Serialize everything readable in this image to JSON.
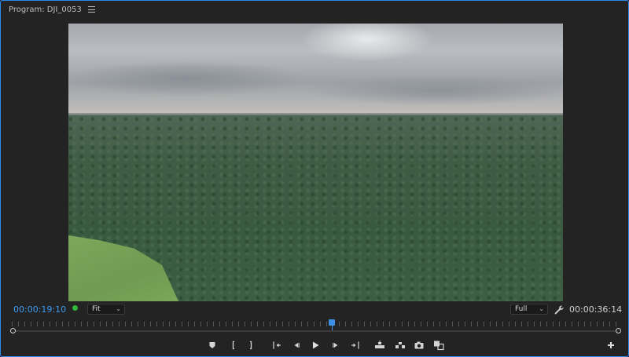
{
  "panel": {
    "title": "Program: DJI_0053"
  },
  "timecodes": {
    "current": "00:00:19:10",
    "duration": "00:00:36:14"
  },
  "zoom_select": {
    "value": "Fit"
  },
  "resolution_select": {
    "value": "Full"
  },
  "playback": {
    "position_fraction": 0.527
  },
  "colors": {
    "accent": "#3d9bf0",
    "status_green": "#2fb83a",
    "panel_border": "#2d8ceb"
  },
  "icons": {
    "menu": "hamburger-icon",
    "wrench": "wrench-icon",
    "add_marker": "marker-icon",
    "mark_in": "mark-in-icon",
    "mark_out": "mark-out-icon",
    "go_to_in": "go-to-in-icon",
    "step_back": "step-back-icon",
    "play": "play-icon",
    "step_forward": "step-forward-icon",
    "go_to_out": "go-to-out-icon",
    "lift": "lift-icon",
    "extract": "extract-icon",
    "export_frame": "camera-icon",
    "comparison": "comparison-view-icon",
    "button_editor": "plus-icon"
  }
}
